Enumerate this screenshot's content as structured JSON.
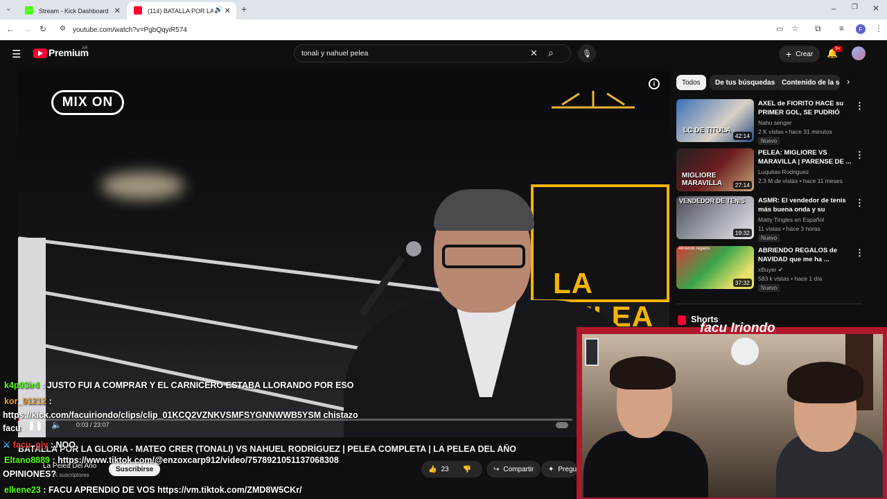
{
  "browser": {
    "tabs": [
      {
        "label": "Stream - Kick Dashboard",
        "favicon_color": "#53fc18"
      },
      {
        "label": "(114) BATALLA POR LA GLO",
        "favicon_color": "#ff0033"
      }
    ],
    "url": "youtube.com/watch?v=PgbQqyiR574",
    "profile_initial": "F"
  },
  "youtube": {
    "logo": "Premium",
    "region": "AR",
    "search_query": "tonali y nahuel pelea",
    "create_label": "Crear",
    "notification_count": "9+"
  },
  "video": {
    "overlay_logo": "MIX ON",
    "sign_text": "LA PELEA",
    "time_current": "0:03",
    "time_total": "23:07",
    "time_separator": "/",
    "progress": 0.002,
    "title": "BATALLA POR LA GLORIA - MATEO CRER (TONALI) VS NAHUEL RODRÍGUEZ | PELEA COMPLETA | LA PELEA DEL AÑO",
    "channel": "La Pelea Del Año",
    "subscribers": "K suscriptores",
    "subscribe_label": "Suscribirse",
    "likes": "23",
    "share_label": "Compartir",
    "ask_label": "Pregu"
  },
  "chips": [
    "Todos",
    "De tus búsquedas",
    "Contenido de la ser"
  ],
  "recommendations": [
    {
      "title": "AXEL de FIORITO HACE su PRIMER GOL, SE PUDRIÓ TOD...",
      "channel": "Nahu senger",
      "views": "2 K vistas",
      "age": "hace 31 minutos",
      "duration": "42:14",
      "badge": "Nuevo",
      "thumb_text": "LC DE TITULA"
    },
    {
      "title": "PELEA: MIGLIORE VS MARAVILLA  | PARENSE DE ...",
      "channel": "Luquitas Rodriguez",
      "views": "2.3 M de vistas",
      "age": "hace 11 meses",
      "duration": "27:14",
      "badge": "",
      "thumb_text": "MIGLIORE MARAVILLA"
    },
    {
      "title": "ASMR: El vendedor de tenis más buena onda y su increíble...",
      "channel": "Matty Tingles en Español",
      "views": "11 vistas",
      "age": "hace 3 horas",
      "duration": "19:32",
      "badge": "Nuevo",
      "thumb_text": "VENDEDOR DE TENIS"
    },
    {
      "title": "ABRIENDO REGALOS de NAVIDAD que me ha ...",
      "channel": "xBuyer",
      "views": "583 k vistas",
      "age": "hace 1 día",
      "duration": "37:32",
      "badge": "Nuevo",
      "thumb_text": "Abriendo regalos"
    }
  ],
  "shorts_label": "Shorts",
  "webcam": {
    "title": "facu Iriondo"
  },
  "chat": [
    {
      "user": "k4p03ir4",
      "sep": " : ",
      "text": "JUSTO FUI A COMPRAR Y EL CARNICERO ESTABA LLORANDO POR ESO"
    },
    {
      "user": "kor_91212",
      "sep": " : ",
      "text": ""
    },
    {
      "user": "",
      "sep": "",
      "text": "https://kick.com/facuiriondo/clips/clip_01KCQ2VZNKVSMFSYGNNWWB5YSM chistazo"
    },
    {
      "user": "",
      "sep": "",
      "text": "facu"
    },
    {
      "user": "facu_gly",
      "sep": " : ",
      "text": "NOO"
    },
    {
      "user": "Eltano8889",
      "sep": " : ",
      "text": "https://www.tiktok.com/@enzoxcarp912/video/7578921051137068308"
    },
    {
      "user": "",
      "sep": "",
      "text": "OPINIONES?"
    },
    {
      "user": "elkene23",
      "sep": " : ",
      "text": "FACU APRENDIO DE VOS https://vm.tiktok.com/ZMD8W5CKr/"
    }
  ]
}
